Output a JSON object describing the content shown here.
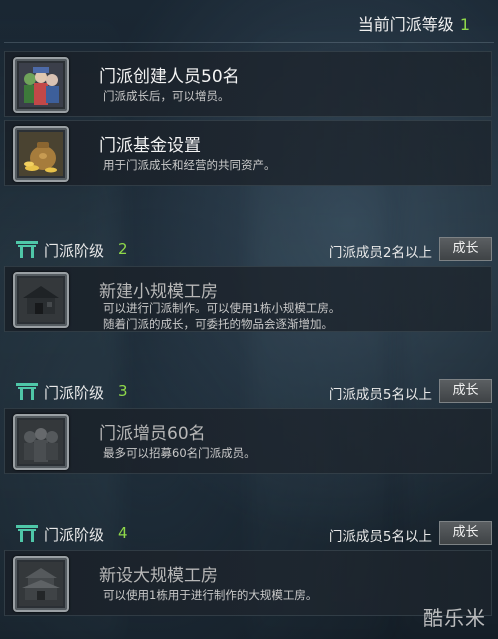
{
  "header": {
    "title": "当前门派等级",
    "level": "1"
  },
  "level1_items": [
    {
      "icon": "people-icon",
      "title": "门派创建人员50名",
      "desc": [
        "门派成长后，可以增员。"
      ]
    },
    {
      "icon": "money-bag-icon",
      "title": "门派基金设置",
      "desc": [
        "用于门派成长和经营的共同资产。"
      ]
    }
  ],
  "stages": [
    {
      "label": "门派阶级",
      "num": "2",
      "requirement": "门派成员2名以上",
      "button": "成长",
      "item": {
        "icon": "workshop-small-icon",
        "title": "新建小规模工房",
        "desc": [
          "可以进行门派制作。可以使用1栋小规模工房。",
          "随着门派的成长，可委托的物品会逐渐增加。"
        ]
      }
    },
    {
      "label": "门派阶级",
      "num": "3",
      "requirement": "门派成员5名以上",
      "button": "成长",
      "item": {
        "icon": "members-icon",
        "title": "门派增员60名",
        "desc": [
          "最多可以招募60名门派成员。"
        ]
      }
    },
    {
      "label": "门派阶级",
      "num": "4",
      "requirement": "门派成员5名以上",
      "button": "成长",
      "item": {
        "icon": "workshop-large-icon",
        "title": "新设大规模工房",
        "desc": [
          "可以使用1栋用于进行制作的大规模工房。"
        ]
      }
    }
  ],
  "watermark": "酷乐米",
  "colors": {
    "accent_green": "#8fd84a",
    "gate_teal": "#4fc7a8"
  }
}
